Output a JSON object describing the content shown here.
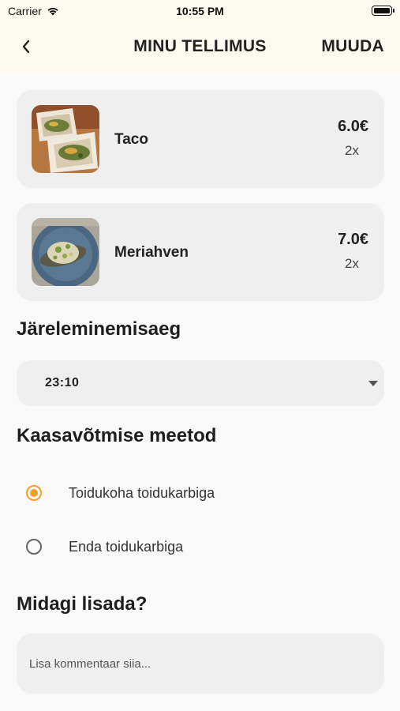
{
  "status_bar": {
    "carrier": "Carrier",
    "time": "10:55 PM"
  },
  "header": {
    "title": "MINU TELLIMUS",
    "edit_label": "MUUDA"
  },
  "order_items": [
    {
      "name": "Taco",
      "price": "6.0€",
      "quantity": "2x",
      "image": "taco-photo"
    },
    {
      "name": "Meriahven",
      "price": "7.0€",
      "quantity": "2x",
      "image": "fish-dish-photo"
    }
  ],
  "pickup_time": {
    "heading": "Järeleminemisaeg",
    "selected_value": "23:10"
  },
  "takeaway_method": {
    "heading": "Kaasavõtmise meetod",
    "options": [
      {
        "label": "Toidukoha toidukarbiga",
        "selected": true
      },
      {
        "label": "Enda toidukarbiga",
        "selected": false
      }
    ]
  },
  "comment": {
    "heading": "Midagi lisada?",
    "placeholder": "Lisa kommentaar siia..."
  },
  "colors": {
    "accent": "#f4a02a",
    "header_bg": "#fcf9f0",
    "card_bg": "#efefef",
    "page_bg": "#f9f9f9"
  }
}
